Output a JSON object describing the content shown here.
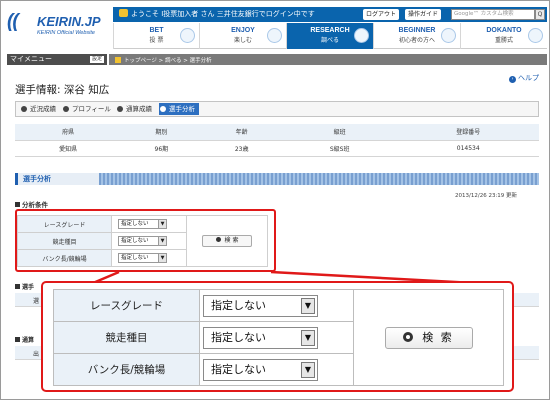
{
  "header": {
    "logo_text": "KEIRIN.JP",
    "logo_tagline": "KEIRIN Official Website",
    "welcome": "ようこそ I投票加入者 さん 三井住友銀行でログイン中です",
    "logout_label": "ログアウト",
    "guide_label": "操作ガイド",
    "search_placeholder": "Google™ カスタム検索",
    "search_button": "Q"
  },
  "nav": [
    {
      "en": "BET",
      "jp": "投 票"
    },
    {
      "en": "ENJOY",
      "jp": "楽しむ"
    },
    {
      "en": "RESEARCH",
      "jp": "調べる"
    },
    {
      "en": "BEGINNER",
      "jp": "初心者の方へ"
    },
    {
      "en": "DOKANTO",
      "jp": "重勝式"
    }
  ],
  "mypage": {
    "label": "マイメニュー",
    "settings": "設定"
  },
  "breadcrumb": "トップページ > 調べる > 選手分析",
  "help_label": "ヘルプ",
  "page_title": "選手情報: 深谷 知広",
  "tabs": [
    {
      "label": "近況成績",
      "active": false
    },
    {
      "label": "プロフィール",
      "active": false
    },
    {
      "label": "通算成績",
      "active": false
    },
    {
      "label": "選手分析",
      "active": true
    }
  ],
  "player_table": {
    "headers": [
      "府県",
      "期別",
      "年齢",
      "級班",
      "登録番号"
    ],
    "values": [
      "愛知県",
      "96期",
      "23歳",
      "S級S班",
      "014534"
    ]
  },
  "analysis_section_title": "選手分析",
  "updated": "2013/12/26 23:19 更新",
  "condition_label": "分析条件",
  "conditions": [
    {
      "label": "レースグレード",
      "value": "指定しない"
    },
    {
      "label": "競走種目",
      "value": "指定しない"
    },
    {
      "label": "バンク長/競輪場",
      "value": "指定しない"
    }
  ],
  "search_button_label": "検 索",
  "section2_label": "選手",
  "section2_col": "選",
  "section3_label": "通算",
  "section3_col": "出",
  "colors": {
    "brand_blue": "#0a64ad",
    "highlight_red": "#e01919"
  }
}
